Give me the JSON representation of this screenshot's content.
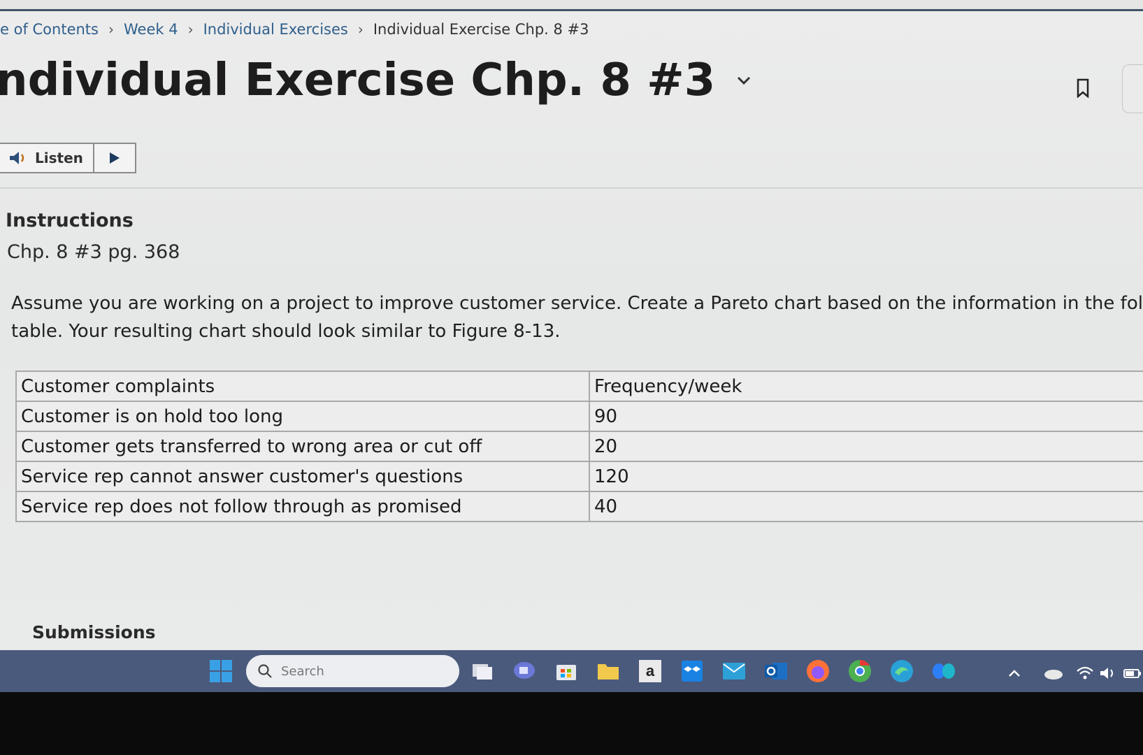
{
  "breadcrumb": {
    "items": [
      "e of Contents",
      "Week 4",
      "Individual Exercises"
    ],
    "current": "Individual Exercise Chp. 8 #3",
    "separator": "›"
  },
  "header": {
    "title": "ndividual Exercise Chp. 8 #3"
  },
  "listen": {
    "label": "Listen"
  },
  "instructions": {
    "heading": "Instructions",
    "reference": "Chp. 8 #3 pg. 368",
    "paragraph_lines": [
      "Assume you are working on a project to improve customer service. Create a Pareto chart based on the information in the followin",
      "table. Your resulting chart should look similar to Figure 8-13."
    ]
  },
  "table": {
    "headers": [
      "Customer complaints",
      "Frequency/week"
    ],
    "rows": [
      [
        "Customer is on hold too long",
        "90"
      ],
      [
        "Customer gets transferred to wrong area or cut off",
        "20"
      ],
      [
        "Service rep cannot answer customer's questions",
        "120"
      ],
      [
        "Service rep does not follow through as promised",
        "40"
      ]
    ]
  },
  "submissions": {
    "label": "Submissions"
  },
  "taskbar": {
    "search_placeholder": "Search",
    "store_letter": "a"
  },
  "colors": {
    "link": "#2f5f8c",
    "taskbar": "#4a5a7c"
  }
}
